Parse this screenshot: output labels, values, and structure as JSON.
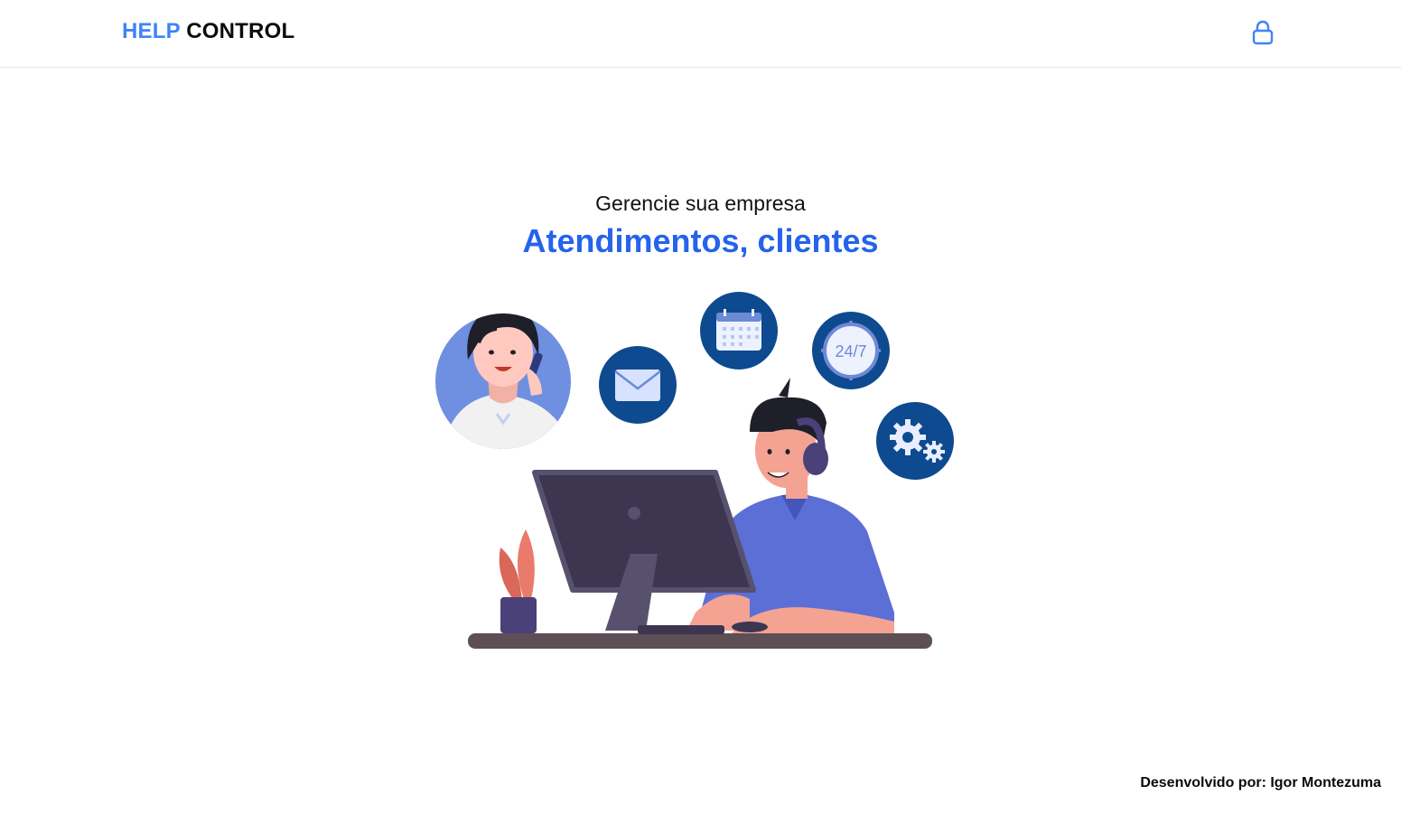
{
  "header": {
    "brand_accent": "HELP",
    "brand_main": "CONTROL",
    "lock_icon": "lock-icon"
  },
  "hero": {
    "subtitle": "Gerencie sua empresa",
    "title": "Atendimentos, clientes"
  },
  "illustration": {
    "icons": [
      "woman-on-phone-icon",
      "envelope-icon",
      "calendar-icon",
      "clock-24-7-icon",
      "gears-icon"
    ],
    "clock_label": "24/7"
  },
  "footer": {
    "credit": "Desenvolvido por: Igor Montezuma"
  },
  "colors": {
    "accent": "#3f83f8",
    "title": "#2563eb",
    "icon_bg": "#0e4a8f"
  }
}
